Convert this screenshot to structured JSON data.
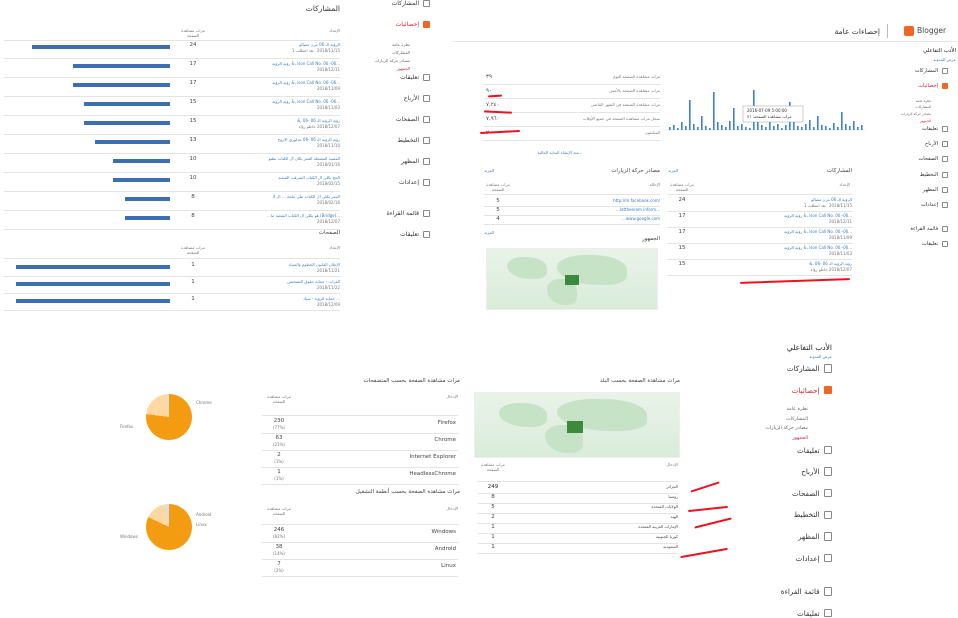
{
  "p1": {
    "heading": "المشاركات",
    "col_views": "مرات مشاهدة الصفحة",
    "col_post": "الإعداد",
    "rows": [
      {
        "v": "24",
        "t": "الرؤية الـ 06 مرن مصالو",
        "d": "2018/11/15 ..هد انتطلت 1",
        "p": 0.85
      },
      {
        "v": "17",
        "t": "...ison Call No. 06 -06 ,& رؤية الرؤية",
        "d": "2018/12/11",
        "p": 0.6
      },
      {
        "v": "17",
        "t": "...ison Call No. 06 -06 ,& رؤية الرؤية",
        "d": "2018/11/09",
        "p": 0.6
      },
      {
        "v": "15",
        "t": "...ison Call No. 06 -06 ,& رؤية الرؤية",
        "d": "2018/11/03",
        "p": 0.53
      },
      {
        "v": "15",
        "t": "رؤية الرؤية الـ 06 -06 ,&",
        "d": "2018/12/07 خاطو رؤاء",
        "p": 0.53
      },
      {
        "v": "13",
        "t": "رؤية الرؤية الـ 06 -06 عدلوري الاروح",
        "d": "2018/11/10",
        "p": 0.46
      },
      {
        "v": "10",
        "t": "المصيد المشعلة المعر بكان ال الكتاب نطنو",
        "d": "2018/01/16",
        "p": 0.35
      },
      {
        "v": "10",
        "t": "الحج بكلى ال الكتاب الشرقت الشعبة",
        "d": "2018/02/15",
        "p": 0.35
      },
      {
        "v": "8",
        "t": "العمر بكلى ال الكتاب على ملحة ... ال 4",
        "d": "2018/02/16",
        "p": 0.28
      },
      {
        "v": "8",
        "t": "...(Bridge) هو بكلى ال الكتاب الشعبة ما...",
        "d": "2018/12/07",
        "p": 0.28
      }
    ],
    "pages_heading": "الصفحات",
    "pages": [
      {
        "v": "1",
        "t": "الإعلان القانون الخطوم والسياد",
        "d": "2018/11/21",
        "p": 0.95
      },
      {
        "v": "1",
        "t": "الفرات - حماية حقوق التشخيص",
        "d": "2018/11/22",
        "p": 0.95
      },
      {
        "v": "1",
        "t": "... حماية الرؤية - سياد",
        "d": "2018/12/09",
        "p": 0.95
      }
    ]
  },
  "nav1": [
    "المشاركات",
    "إحصائيات",
    "نظرة عامة",
    "المشاركات",
    "مصادر حركة الزيارات",
    "الجمهور",
    "تعليقات",
    "الأرباح",
    "الصفحات",
    "التخطيط",
    "المظهر",
    "إعدادات",
    "قائمة القراءة",
    "تعليقات"
  ],
  "top": {
    "logo": "Blogger",
    "title": "إحصاءات عامة",
    "blog": "الأدب التفاعلي",
    "sub": "عرض المدونة",
    "nav": [
      "المشاركات",
      "إحصائيات",
      "نظرة عامة",
      "المشاركات",
      "مصادر حركة الزيارات",
      "الجمهور",
      "تعليقات",
      "الأرباح",
      "الصفحات",
      "التخطيط",
      "المظهر",
      "إعدادات",
      "قائمة القراءة",
      "تعليقات"
    ],
    "stats": [
      {
        "v": "٣٩",
        "l": "مرات مشاهدة الصفحة اليوم"
      },
      {
        "v": "٩٠",
        "l": "مرات مشاهدة الصفحة بالأمس"
      },
      {
        "v": "٧,٢٤٠",
        "l": "مرات مشاهدة الصفحة في الشهر الماضي"
      },
      {
        "v": "٧,٩٦٠",
        "l": "سجل مرات مشاهدة الصفحة في جميع الأوقات"
      },
      {
        "v": "٢",
        "l": "المتابعون"
      }
    ],
    "chart_note": "...منذ الإنشاء البداية الحالية",
    "tooltip1": "2016-07-09 5:00:00",
    "tooltip2": "مرات مشاهدة الصفحة: ٧٦",
    "posts_heading": "المشاركات",
    "more": "المزيد",
    "col_views": "مرات مشاهدة الصفحة",
    "col_post": "الإعداد",
    "posts": [
      {
        "v": "24",
        "t": "الرؤية الـ 06 مرن مصالو",
        "d": "2018/11/15 ..هد انتطلت 1"
      },
      {
        "v": "17",
        "t": "...ison Call No. 06 -06 ,& رؤية الرؤية",
        "d": "2018/12/11"
      },
      {
        "v": "17",
        "t": "...ison Call No. 06 -06 ,& رؤية الرؤية",
        "d": "2018/11/09"
      },
      {
        "v": "15",
        "t": "...ison Call No. 06 -06 ,& رؤية الرؤية",
        "d": "2018/11/03"
      },
      {
        "v": "15",
        "t": "رؤية الرؤية الـ 06 -06 ,&",
        "d": "2018/12/07 خاطو رؤاء"
      }
    ],
    "sources_heading": "مصادر حركة الزيارات",
    "col_ref": "الإحالة",
    "sources": [
      {
        "v": "5",
        "t": "http://m.facebook.com/"
      },
      {
        "v": "5",
        "t": "...lattheorem.inform..."
      },
      {
        "v": "4",
        "t": "...www.google.com"
      }
    ],
    "audience_heading": "الجمهور"
  },
  "bottom": {
    "blog": "الأدب التفاعلي",
    "sub": "عرض المدونة",
    "nav": [
      "المشاركات",
      "إحصائيات",
      "نظرة عامة",
      "المشاركات",
      "مصادر حركة الزيارات",
      "الجمهور",
      "تعليقات",
      "الأرباح",
      "الصفحات",
      "التخطيط",
      "المظهر",
      "إعدادات",
      "قائمة القراءة",
      "تعليقات"
    ],
    "country_heading": "مرات مشاهدة الصفحة بحسب البلد",
    "col_views": "مرات مشاهدة الصفحة",
    "col_entry": "الإدخال",
    "countries": [
      {
        "v": "249",
        "t": "الجزائر"
      },
      {
        "v": "8",
        "t": "روسيا"
      },
      {
        "v": "5",
        "t": "الولايات المتحدة"
      },
      {
        "v": "2",
        "t": "الهند"
      },
      {
        "v": "1",
        "t": "الإمارات العربية المتحدة"
      },
      {
        "v": "1",
        "t": "كوريا الجنوبية"
      },
      {
        "v": "1",
        "t": "السعودية"
      }
    ],
    "browser_heading": "مرات مشاهدة الصفحة بحسب المتصفحات",
    "browsers": [
      {
        "t": "Firefox",
        "v": "230",
        "pct": "(77%)"
      },
      {
        "t": "Chrome",
        "v": "63",
        "pct": "(21%)"
      },
      {
        "t": "Internet Explorer",
        "v": "2",
        "pct": "(1%)"
      },
      {
        "t": "HeadlessChrome",
        "v": "1",
        "pct": "(1%)"
      }
    ],
    "os_heading": "مرات مشاهدة الصفحة بحسب أنظمة التشغيل",
    "os": [
      {
        "t": "Windows",
        "v": "246",
        "pct": "(82%)"
      },
      {
        "t": "Android",
        "v": "38",
        "pct": "(14%)"
      },
      {
        "t": "Linux",
        "v": "7",
        "pct": "(2%)"
      }
    ],
    "pie1_labels": [
      "Chrome",
      "Firefox"
    ],
    "pie2_labels": [
      "Android",
      "Linux",
      "Windows"
    ]
  }
}
